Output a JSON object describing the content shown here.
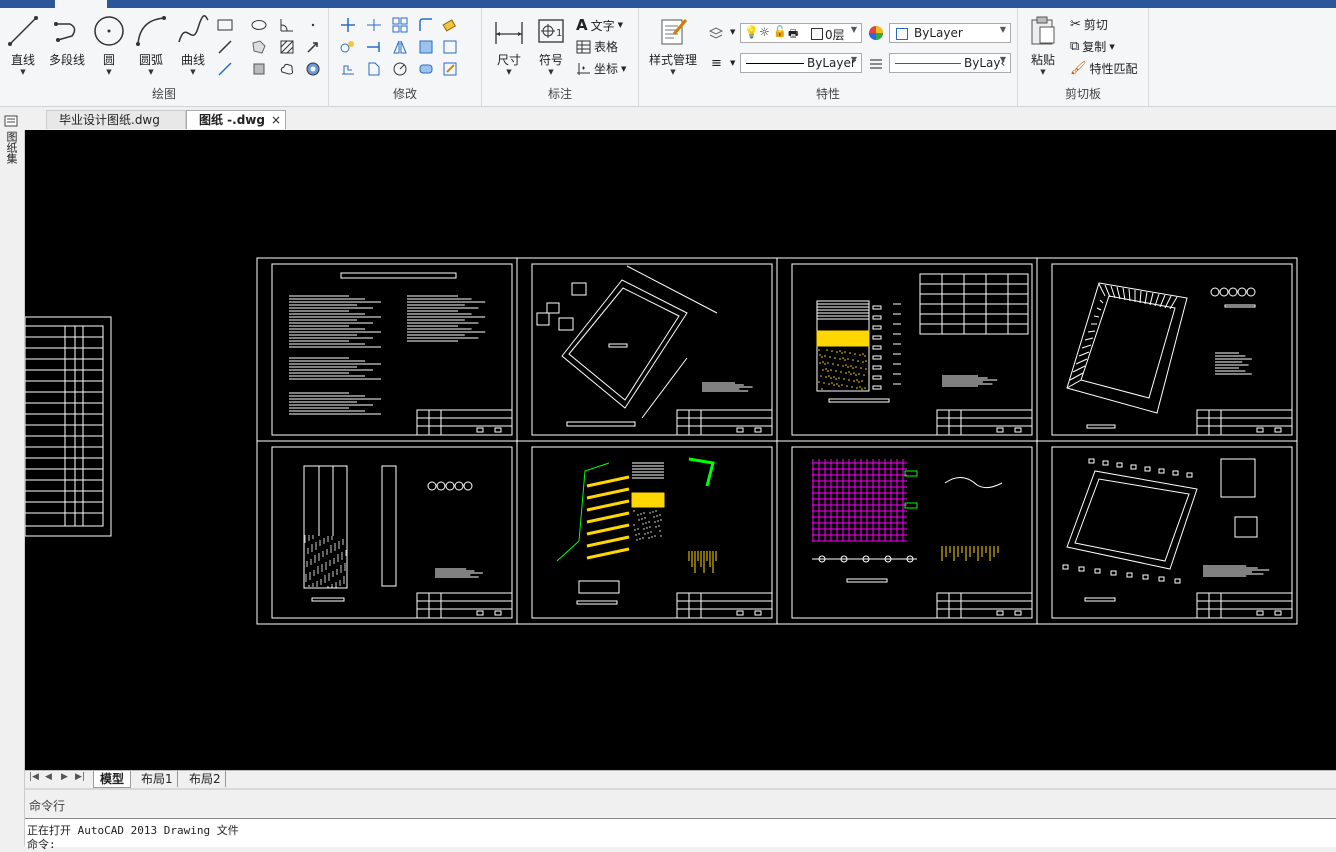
{
  "ribbon": {
    "draw": {
      "title": "绘图",
      "line": "直线",
      "polyline": "多段线",
      "circle": "圆",
      "arc": "圆弧",
      "curve": "曲线"
    },
    "modify": {
      "title": "修改"
    },
    "annotate": {
      "title": "标注",
      "dimension": "尺寸",
      "symbol": "符号",
      "text": "文字",
      "table": "表格",
      "coordinate": "坐标"
    },
    "properties": {
      "title": "特性",
      "style_manager": "样式管理",
      "layer": "0层",
      "color": "ByLayer",
      "linetype": "ByLayer",
      "lineweight": "ByLay‹"
    },
    "clipboard": {
      "title": "剪切板",
      "paste": "粘贴",
      "cut": "剪切",
      "copy": "复制",
      "match": "特性匹配"
    }
  },
  "left_toolbar": {
    "label": "图纸集"
  },
  "document_tabs": [
    {
      "label": "毕业设计图纸.dwg",
      "active": false
    },
    {
      "label": "图纸 -.dwg",
      "active": true
    }
  ],
  "layout_tabs": [
    {
      "label": "模型",
      "active": true
    },
    {
      "label": "布局1",
      "active": false
    },
    {
      "label": "布局2",
      "active": false
    }
  ],
  "command": {
    "title": "命令行",
    "lines": [
      "正在打开 AutoCAD 2013 Drawing 文件",
      "命令:"
    ]
  },
  "colors": {
    "accent": "#2b579a",
    "canvas": "#000000",
    "drawing_line": "#ffffff",
    "hatch_yellow": "#ffd700",
    "magenta": "#ff00ff",
    "green": "#00ff00"
  }
}
